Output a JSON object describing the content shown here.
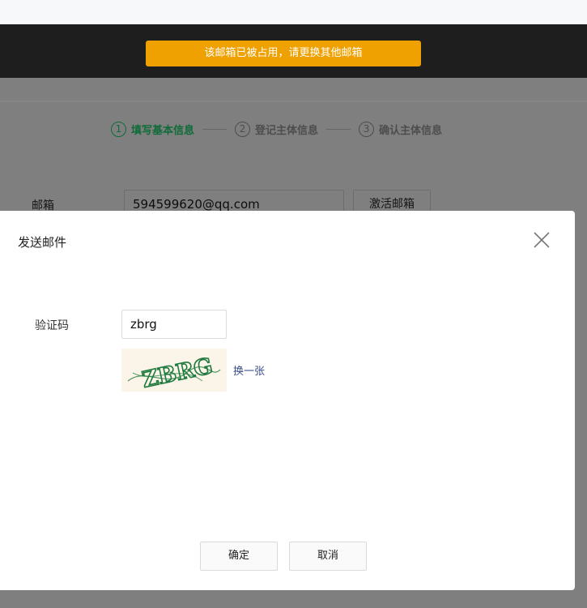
{
  "toast": {
    "message": "该邮箱已被占用，请更换其他邮箱"
  },
  "steps": [
    {
      "num": "1",
      "label": "填写基本信息"
    },
    {
      "num": "2",
      "label": "登记主体信息"
    },
    {
      "num": "3",
      "label": "确认主体信息"
    }
  ],
  "form": {
    "email_label": "邮箱",
    "email_value": "594599620@qq.com",
    "activate_label": "激活邮箱"
  },
  "modal": {
    "title": "发送邮件",
    "captcha_label": "验证码",
    "captcha_value": "zbrg",
    "captcha_image_text": "ZBRG",
    "refresh_label": "换一张",
    "confirm_label": "确定",
    "cancel_label": "取消"
  },
  "colors": {
    "toast_bg": "#eea100",
    "step_active": "#0f6b38",
    "link": "#3a4d88",
    "overlay": "#7f7f80",
    "captcha_ink": "#1f7a3f"
  }
}
